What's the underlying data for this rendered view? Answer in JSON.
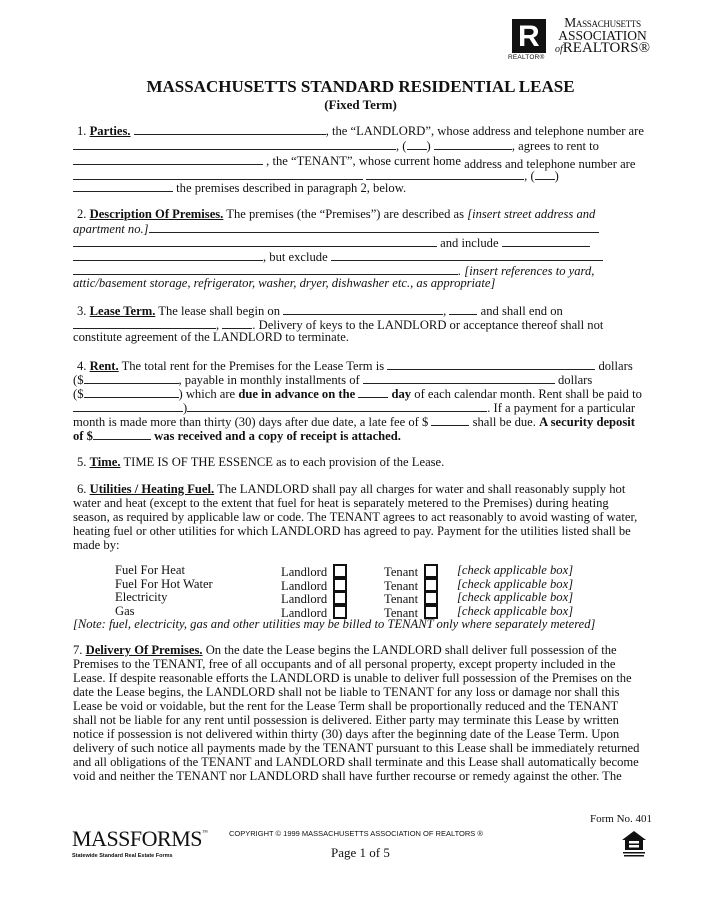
{
  "header": {
    "logo": {
      "icon": "realtor-r-logo-icon",
      "mark_letter": "R",
      "realtor_label": "REALTOR®",
      "org_line1": "Massachusetts",
      "org_line2": "ASSOCIATION",
      "org_line3_prefix": "of",
      "org_line3": "REALTORS®"
    },
    "title": "MASSACHUSETTS STANDARD RESIDENTIAL LEASE",
    "subtitle": "(Fixed Term)"
  },
  "sections": {
    "parties": {
      "number": "1.",
      "heading": "Parties.",
      "t1": ", the “LANDLORD”, whose address and telephone number are",
      "t2": ", (",
      "t3": ")",
      "t4": ", agrees to rent to",
      "t5": ", the “TENANT”, whose current home",
      "t6": "address and telephone number are",
      "t7": ", (",
      "t8": ")",
      "t9": "the premises described in paragraph 2, below."
    },
    "premises": {
      "number": "2.",
      "heading": "Description Of Premises.",
      "t1": "The premises (the “Premises”) are described as",
      "t1_italic": "[insert street address and",
      "t2_italic": "apartment no.]",
      "t3": "and include",
      "t4": ", but exclude",
      "t5_italic": ". [insert references to yard,",
      "t6_italic": "attic/basement storage, refrigerator, washer, dryer, dishwasher etc., as appropriate]"
    },
    "lease_term": {
      "number": "3.",
      "heading": "Lease Term.",
      "t1": "The lease shall begin on",
      "t2": "and shall end on",
      "t3": ". Delivery of keys to the LANDLORD or acceptance thereof shall not",
      "t4": "constitute agreement of the LANDLORD to terminate."
    },
    "rent": {
      "number": "4.",
      "heading": "Rent.",
      "t1": "The total rent for the Premises for the Lease Term is",
      "t2": "dollars",
      "t3": "($",
      "t4": ", payable in monthly installments of",
      "t5": "dollars",
      "t6": "($",
      "t7": ") which are",
      "t7_bold": "due in advance on the",
      "t8_bold": "day",
      "t8": "of each calendar month. Rent shall be paid to",
      "t9": ")",
      "t10": ". If a payment for a particular",
      "t11": "month is made more than thirty (30) days after due date, a late fee of $",
      "t12": "shall be due.",
      "t12_bold": "A security deposit",
      "t13_bold": "of $",
      "t14_bold": "was received and a copy of receipt is attached."
    },
    "time": {
      "number": "5.",
      "heading": "Time.",
      "text": "TIME IS OF THE ESSENCE as to each provision of the Lease."
    },
    "utilities": {
      "number": "6.",
      "heading": "Utilities / Heating Fuel.",
      "lines": [
        "The LANDLORD shall pay all charges for water and shall reasonably supply hot",
        "water and heat (except to the extent that fuel for heat is separately metered to the Premises) during heating",
        "season, as required by applicable law or code.  The TENANT agrees to act reasonably to avoid wasting of water,",
        "heating fuel or other utilities for which LANDLORD has agreed to pay.  Payment for the utilities listed shall be",
        "made by:"
      ],
      "landlord_label": "Landlord",
      "tenant_label": "Tenant",
      "instruction": "[check applicable box]",
      "rows": [
        {
          "name": "Fuel For Heat",
          "landlord_checked": false,
          "tenant_checked": false
        },
        {
          "name": "Fuel For Hot Water",
          "landlord_checked": false,
          "tenant_checked": false
        },
        {
          "name": "Electricity",
          "landlord_checked": false,
          "tenant_checked": false
        },
        {
          "name": "Gas",
          "landlord_checked": false,
          "tenant_checked": false
        }
      ],
      "note": "[Note: fuel, electricity, gas and other utilities may be billed to TENANT only where separately metered]"
    },
    "delivery": {
      "number": "7.",
      "heading": "Delivery Of Premises.",
      "lines": [
        "On the date the Lease begins the LANDLORD shall deliver full possession of the",
        "Premises to the TENANT, free of all occupants and of all personal property, except property included in the",
        "Lease.  If despite reasonable efforts the LANDLORD is unable to deliver full possession of the Premises on the",
        "date the Lease begins, the LANDLORD shall not be liable to TENANT for any loss or damage nor shall this",
        "Lease be void or voidable, but the rent for the Lease Term shall be proportionally reduced and the TENANT",
        "shall not be liable for any rent until possession is delivered.  Either party may terminate this Lease by written",
        "notice if possession is not delivered within thirty (30) days after the beginning date of the Lease Term.  Upon",
        "delivery of such notice all payments made by the TENANT pursuant to this Lease shall be immediately returned",
        "and all obligations of the TENANT and LANDLORD shall terminate and this Lease shall automatically become",
        "void and neither the TENANT nor LANDLORD shall have further recourse or remedy against the other.  The"
      ]
    }
  },
  "footer": {
    "brand": "MASSFORMS",
    "brand_mark": "™",
    "tagline": "Statewide Standard Real Estate Forms",
    "copyright": "COPYRIGHT © 1999 MASSACHUSETTS ASSOCIATION OF REALTORS ®",
    "page": "Page 1 of 5",
    "form_no": "Form No. 401",
    "equal_housing_icon": "equal-housing-opportunity-icon"
  }
}
